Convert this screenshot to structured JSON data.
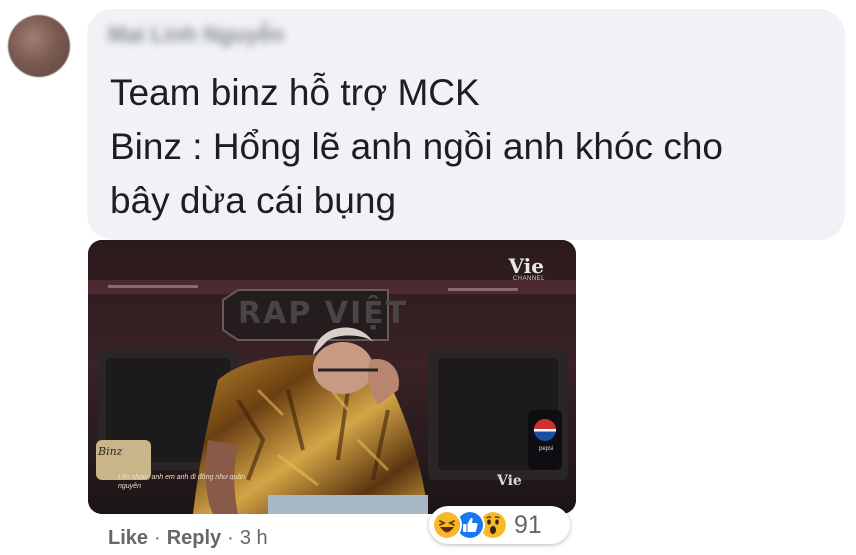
{
  "comment": {
    "author": "Mai Linh Nguyễn",
    "lines": [
      "Team binz hỗ trợ MCK",
      "Binz : Hổng lẽ anh ngồi anh khóc cho",
      "bây dừa cái bụng"
    ]
  },
  "media": {
    "brand": "Vie",
    "channel": "CHANNEL",
    "stage_sign": "RAP VIỆT",
    "sponsor": "pepsi",
    "bottom_logo": "Vie",
    "caption_badge": "Binz",
    "caption": "Lên show, anh em anh đi đồng như quân nguyên"
  },
  "actions": {
    "like": "Like",
    "reply": "Reply",
    "separator": "·",
    "time": "3 h"
  },
  "reactions": {
    "icons": [
      "haha-icon",
      "like-icon",
      "wow-icon"
    ],
    "count": "91"
  },
  "colors": {
    "bubble": "#f0f2f5",
    "text": "#1c1e21",
    "meta": "#65676b",
    "like_blue": "#1877f2",
    "emoji_yellow": "#f7b928"
  }
}
